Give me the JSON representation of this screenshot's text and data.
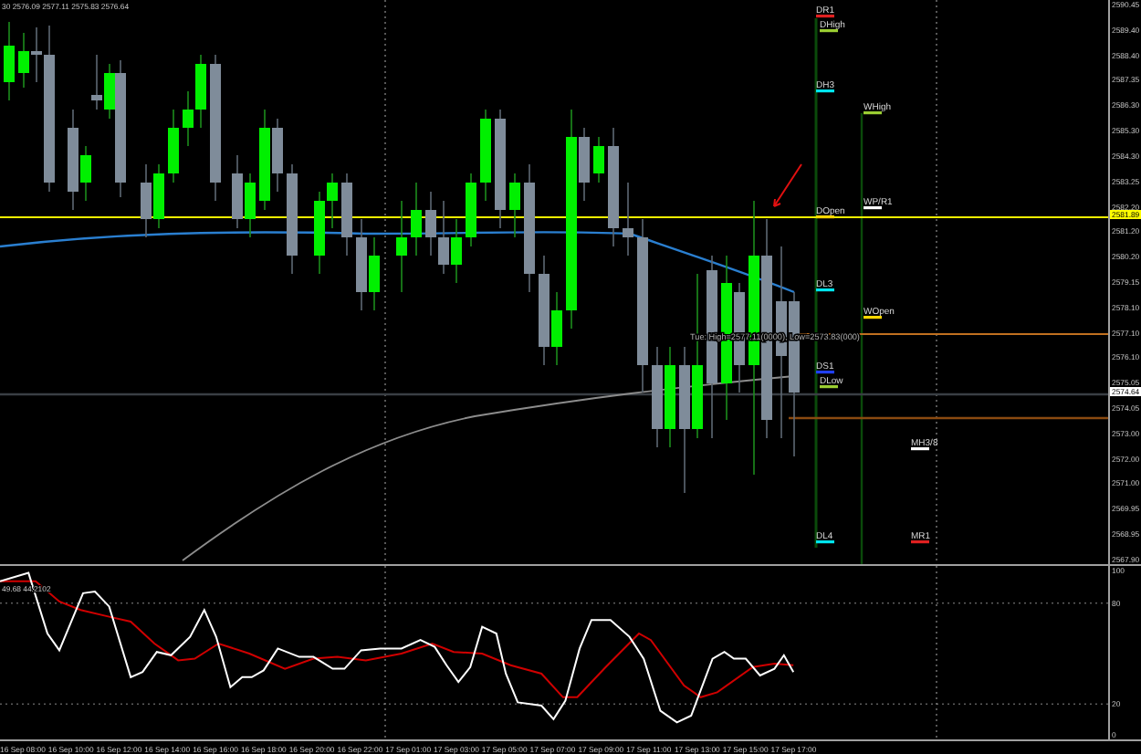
{
  "header": {
    "text": "30 2576.09 2577.11 2575.83 2576.64"
  },
  "price_axis": {
    "labels": [
      "2590.45",
      "2589.40",
      "2588.40",
      "2587.35",
      "2586.30",
      "2585.30",
      "2584.30",
      "2583.25",
      "2582.20",
      "2581.20",
      "2580.20",
      "2579.15",
      "2578.10",
      "2577.10",
      "2576.10",
      "2575.05",
      "2574.05",
      "2573.00",
      "2572.00",
      "2571.00",
      "2569.95",
      "2568.95",
      "2567.90"
    ],
    "markers": [
      {
        "text": "2581.89",
        "color": "#ffff00"
      },
      {
        "text": "2574.64",
        "color": "#ffffff"
      }
    ]
  },
  "levels": [
    {
      "label": "DR1",
      "color": "#e02020"
    },
    {
      "label": "DHigh",
      "color": "#9acd32"
    },
    {
      "label": "DH3",
      "color": "#00e5ee"
    },
    {
      "label": "WHigh",
      "color": "#9acd32"
    },
    {
      "label": "DOpen",
      "color": "#ffd700"
    },
    {
      "label": "WP/R1",
      "color": "#ffffff"
    },
    {
      "label": "DL3",
      "color": "#00e5ee"
    },
    {
      "label": "WOpen",
      "color": "#ffd700"
    },
    {
      "label": "DS1",
      "color": "#2040ff"
    },
    {
      "label": "DLow",
      "color": "#9acd32"
    },
    {
      "label": "MH3/8",
      "color": "#ffffff"
    },
    {
      "label": "DL4",
      "color": "#00e5ee"
    },
    {
      "label": "MR1",
      "color": "#e02020"
    }
  ],
  "session_note": "Tue: High=2577.11(0000), Low=2573.83(000)",
  "oscillator": {
    "label": "49.68 44.2102",
    "axis_labels": [
      "100",
      "80",
      "20",
      "0"
    ]
  },
  "time_axis": {
    "labels": [
      "16 Sep 08:00",
      "16 Sep 10:00",
      "16 Sep 12:00",
      "16 Sep 14:00",
      "16 Sep 16:00",
      "16 Sep 18:00",
      "16 Sep 20:00",
      "16 Sep 22:00",
      "17 Sep 01:00",
      "17 Sep 03:00",
      "17 Sep 05:00",
      "17 Sep 07:00",
      "17 Sep 09:00",
      "17 Sep 11:00",
      "17 Sep 13:00",
      "17 Sep 15:00",
      "17 Sep 17:00"
    ]
  }
}
